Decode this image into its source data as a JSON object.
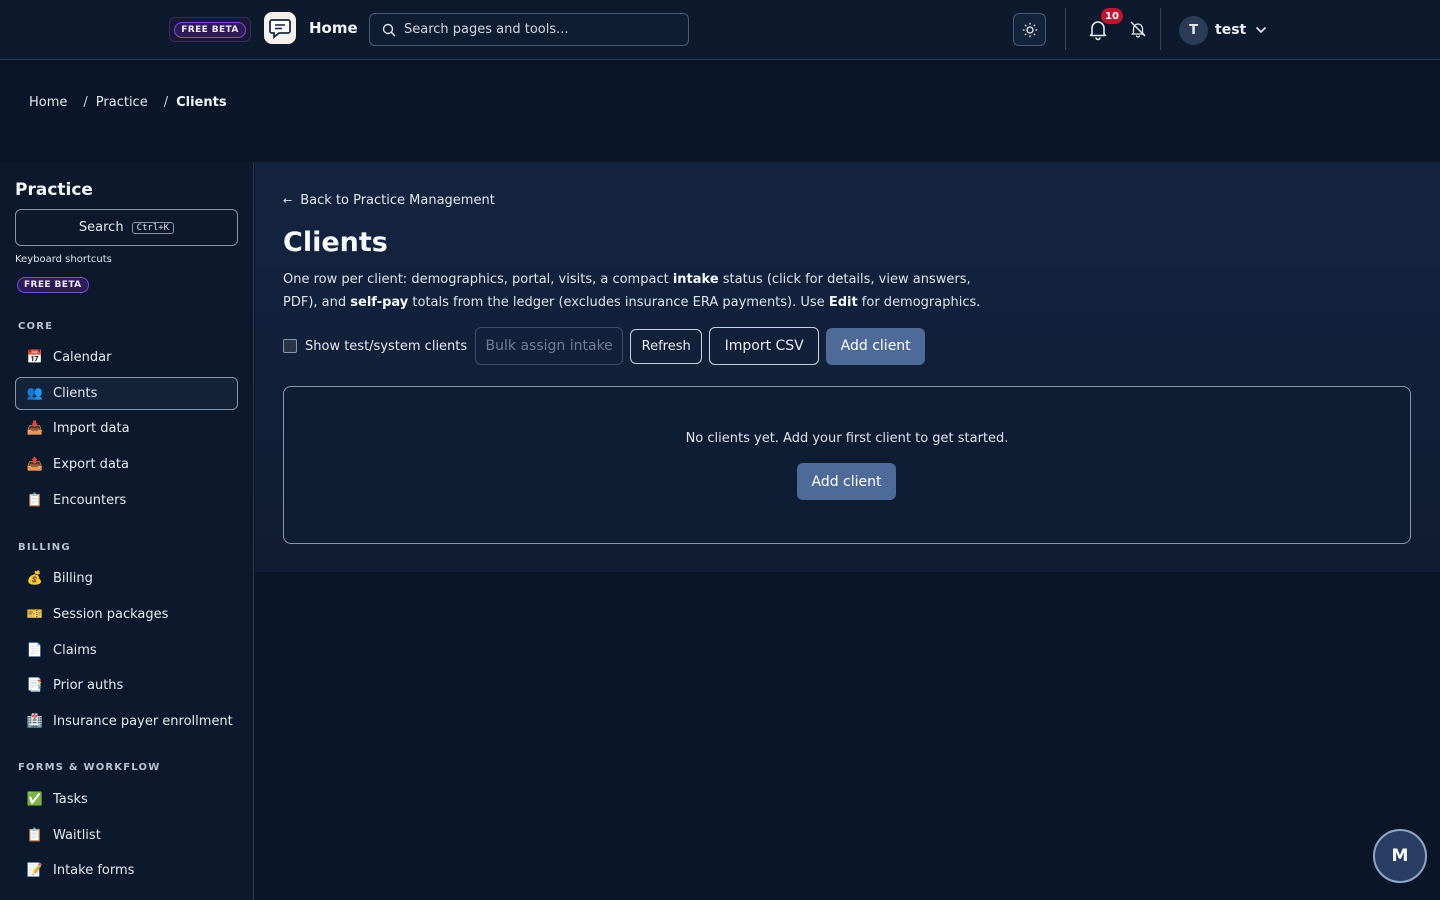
{
  "topbar": {
    "beta_badge": "FREE BETA",
    "home_label": "Home",
    "search_placeholder": "Search pages and tools...",
    "notification_count": "10",
    "user_initial": "T",
    "user_name": "test"
  },
  "breadcrumb": {
    "items": [
      "Home",
      "Practice",
      "Clients"
    ],
    "separator": "/"
  },
  "sidebar": {
    "title": "Practice",
    "search_label": "Search",
    "search_shortcut": "Ctrl+K",
    "shortcuts_label": "Keyboard shortcuts",
    "beta_badge": "FREE BETA",
    "sections": [
      {
        "label": "CORE",
        "items": [
          {
            "label": "Calendar",
            "icon": "calendar-icon"
          },
          {
            "label": "Clients",
            "icon": "users-icon",
            "active": true
          },
          {
            "label": "Import data",
            "icon": "inbox-tray-icon"
          },
          {
            "label": "Export data",
            "icon": "outbox-tray-icon"
          },
          {
            "label": "Encounters",
            "icon": "clipboard-icon"
          }
        ]
      },
      {
        "label": "BILLING",
        "items": [
          {
            "label": "Billing",
            "icon": "money-bag-icon"
          },
          {
            "label": "Session packages",
            "icon": "ticket-icon"
          },
          {
            "label": "Claims",
            "icon": "page-icon"
          },
          {
            "label": "Prior auths",
            "icon": "notepad-icon"
          },
          {
            "label": "Insurance payer enrollment",
            "icon": "hospital-icon"
          }
        ]
      },
      {
        "label": "FORMS & WORKFLOW",
        "items": [
          {
            "label": "Tasks",
            "icon": "check-mark-icon"
          },
          {
            "label": "Waitlist",
            "icon": "clipboard-icon"
          },
          {
            "label": "Intake forms",
            "icon": "memo-icon"
          }
        ]
      }
    ]
  },
  "main": {
    "back_link": "Back to Practice Management",
    "title": "Clients",
    "description": {
      "part1": "One row per client: demographics, portal, visits, a compact ",
      "bold1": "intake",
      "part2": " status (click for details, view answers, PDF), and ",
      "bold2": "self-pay",
      "part3": " totals from the ledger (excludes insurance ERA payments). Use ",
      "bold3": "Edit",
      "part4": " for demographics."
    },
    "toolbar": {
      "show_test_label": "Show test/system clients",
      "bulk_assign_label": "Bulk assign intake",
      "refresh_label": "Refresh",
      "import_csv_label": "Import CSV",
      "add_client_label": "Add client"
    },
    "empty_state": {
      "message": "No clients yet. Add your first client to get started.",
      "add_label": "Add client"
    }
  },
  "fab": {
    "label": "M"
  },
  "colors": {
    "background": "#0a1628",
    "accent_button": "#4d6a99",
    "beta_purple": "#7c4ddb",
    "notification_red": "#c8102e"
  }
}
